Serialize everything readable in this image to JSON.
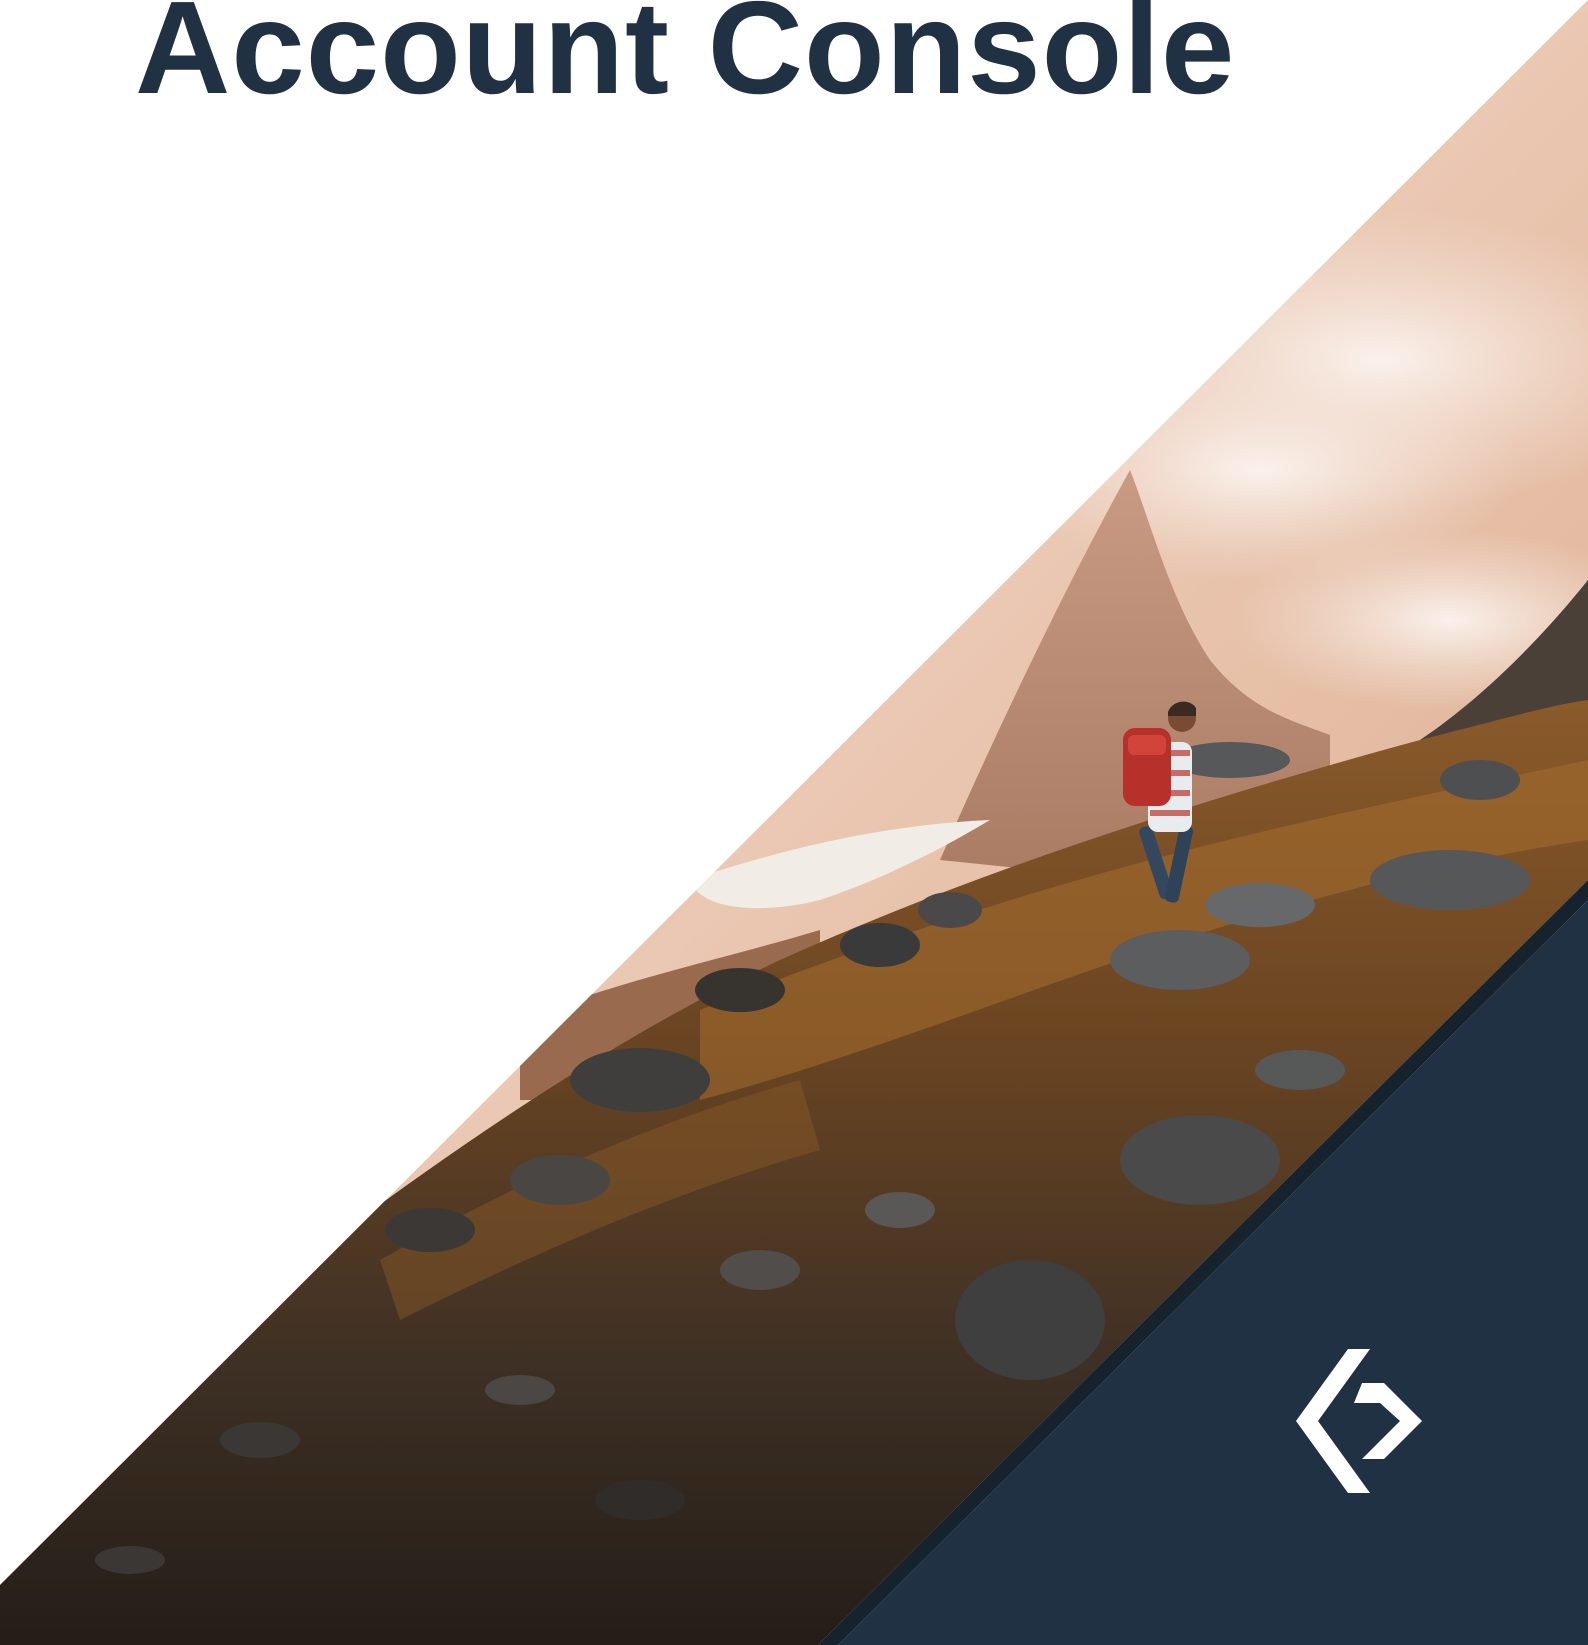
{
  "page": {
    "title": "Account Console"
  },
  "colors": {
    "brand_navy": "#1f3142",
    "background": "#ffffff",
    "logo": "#ffffff"
  },
  "hero_image": {
    "subject": "hiker-with-red-backpack-on-rocky-mountain-slope"
  },
  "icons": {
    "logo": "brand-chevron-logo-icon"
  }
}
